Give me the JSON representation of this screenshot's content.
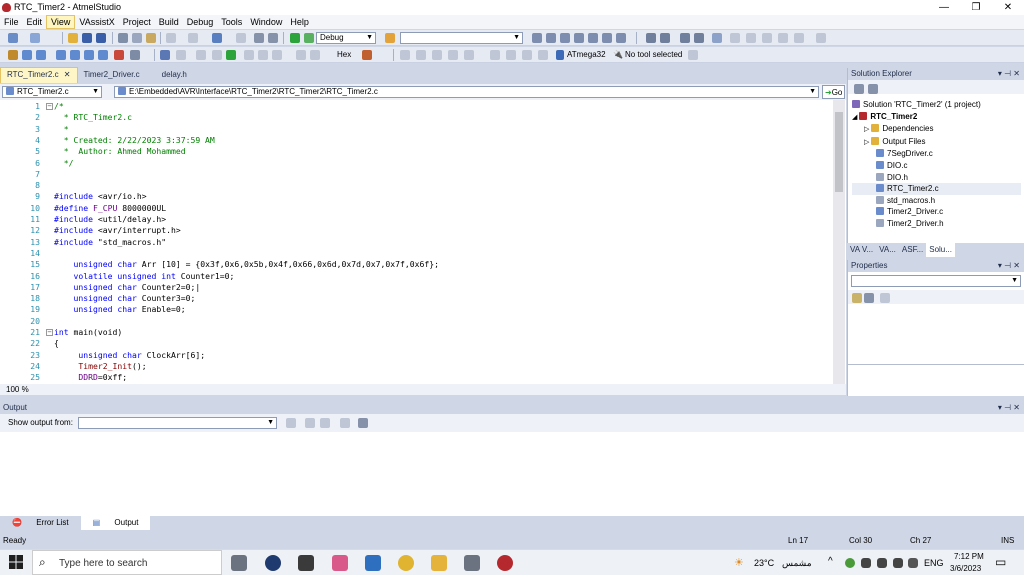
{
  "window": {
    "title": "RTC_Timer2 - AtmelStudio",
    "minimize": "—",
    "maximize": "❐",
    "close": "✕"
  },
  "menu": [
    "File",
    "Edit",
    "View",
    "VAssistX",
    "Project",
    "Build",
    "Debug",
    "Tools",
    "Window",
    "Help"
  ],
  "menu_active": "View",
  "toolbar": {
    "config": "Debug",
    "hex_label": "Hex",
    "device": "ATmega32",
    "tool": "No tool selected"
  },
  "doc_tabs": [
    {
      "label": "RTC_Timer2.c",
      "close": "✕"
    },
    {
      "label": "Timer2_Driver.c"
    },
    {
      "label": "delay.h"
    }
  ],
  "nav": {
    "scope": "RTC_Timer2.c",
    "path": "E:\\Embedded\\AVR\\Interface\\RTC_Timer2\\RTC_Timer2\\RTC_Timer2.c",
    "go": "Go"
  },
  "editor": {
    "line_numbers": [
      "1",
      "2",
      "3",
      "4",
      "5",
      "6",
      "7",
      "8",
      "9",
      "10",
      "11",
      "12",
      "13",
      "14",
      "15",
      "16",
      "17",
      "18",
      "19",
      "20",
      "21",
      "22",
      "23",
      "24",
      "25"
    ],
    "zoom": "100 %"
  },
  "solution_explorer": {
    "title": "Solution Explorer",
    "solution": "Solution 'RTC_Timer2' (1 project)",
    "project": "RTC_Timer2",
    "items": [
      "Dependencies",
      "Output Files",
      "7SegDriver.c",
      "DIO.c",
      "DIO.h",
      "RTC_Timer2.c",
      "std_macros.h",
      "Timer2_Driver.c",
      "Timer2_Driver.h"
    ],
    "tabs": [
      "VA V...",
      "VA...",
      "ASF...",
      "Solu..."
    ]
  },
  "properties": {
    "title": "Properties"
  },
  "output": {
    "title": "Output",
    "show_from": "Show output from:"
  },
  "bottom_tabs": [
    "Error List",
    "Output"
  ],
  "status": {
    "ready": "Ready",
    "ln": "Ln 17",
    "col": "Col 30",
    "ch": "Ch 27",
    "ins": "INS"
  },
  "taskbar": {
    "search": "Type here to search",
    "weather": "23°C",
    "weather_text": "مشمس",
    "lang": "ENG",
    "time": "7:12 PM",
    "date": "3/6/2023"
  }
}
